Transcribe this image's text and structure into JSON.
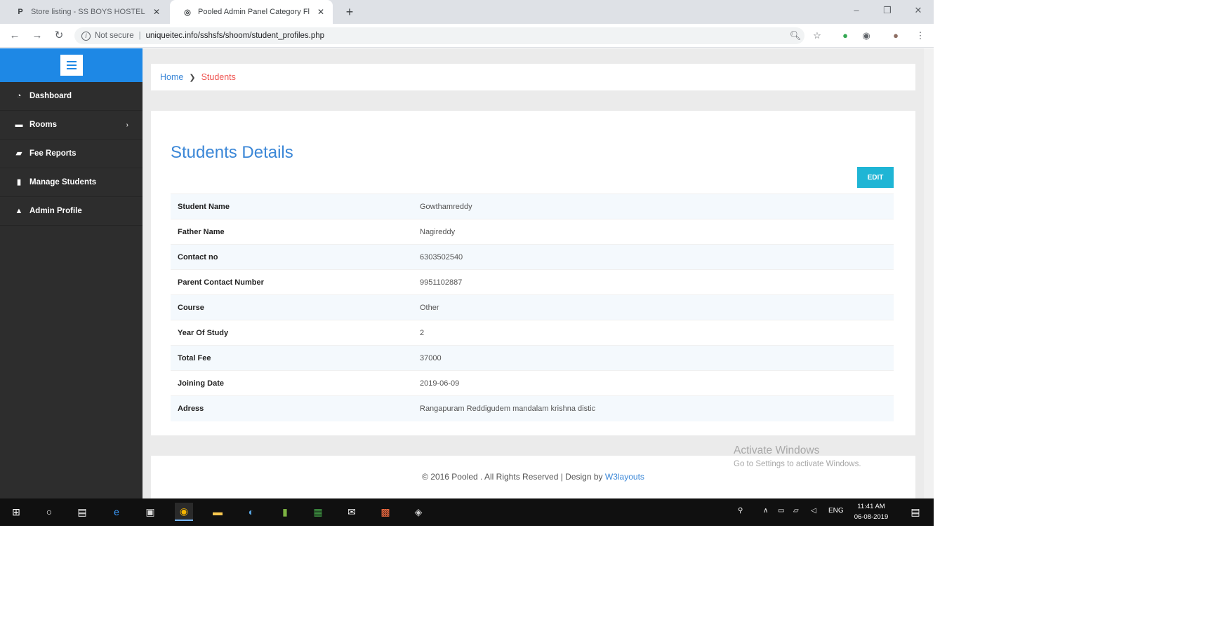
{
  "browser": {
    "tabs": [
      {
        "title": "Store listing - SS BOYS HOSTEL"
      },
      {
        "title": "Pooled Admin Panel Category Fl"
      }
    ],
    "omnibox": {
      "security": "Not secure",
      "url": "uniqueitec.info/sshsfs/shoom/student_profiles.php"
    }
  },
  "sidebar": {
    "items": [
      {
        "label": "Dashboard",
        "icon": "dashboard-icon"
      },
      {
        "label": "Rooms",
        "icon": "folder-icon"
      },
      {
        "label": "Fee Reports",
        "icon": "book-icon"
      },
      {
        "label": "Manage Students",
        "icon": "file-icon"
      },
      {
        "label": "Admin Profile",
        "icon": "user-icon"
      }
    ]
  },
  "breadcrumb": {
    "home": "Home",
    "current": "Students"
  },
  "page": {
    "title": "Students Details",
    "edit_label": "EDIT",
    "details": [
      {
        "label": "Student Name",
        "value": "Gowthamreddy"
      },
      {
        "label": "Father Name",
        "value": "Nagireddy"
      },
      {
        "label": "Contact no",
        "value": "6303502540"
      },
      {
        "label": "Parent Contact Number",
        "value": "9951102887"
      },
      {
        "label": "Course",
        "value": "Other"
      },
      {
        "label": "Year Of Study",
        "value": "2"
      },
      {
        "label": "Total Fee",
        "value": "37000"
      },
      {
        "label": "Joining Date",
        "value": "2019-06-09"
      },
      {
        "label": "Adress",
        "value": "Rangapuram Reddigudem mandalam krishna distic"
      }
    ]
  },
  "footer": {
    "text": "© 2016 Pooled . All Rights Reserved | Design by",
    "brand": "W3layouts"
  },
  "watermark": {
    "line1": "Activate Windows",
    "line2": "Go to Settings to activate Windows."
  },
  "taskbar": {
    "lang": "ENG",
    "time": "11:41 AM",
    "date": "06-08-2019"
  }
}
